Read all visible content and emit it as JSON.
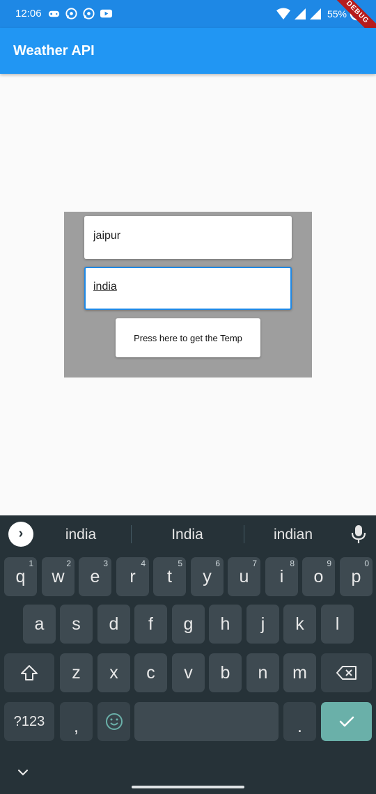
{
  "status_bar": {
    "time": "12:06",
    "battery_text": "55%",
    "debug_label": "DEBUG",
    "icons": [
      "gamepad-icon",
      "whatsapp-icon",
      "whatsapp-icon",
      "youtube-icon",
      "wifi-icon",
      "signal-icon",
      "signal-icon",
      "battery-icon"
    ]
  },
  "app_bar": {
    "title": "Weather API"
  },
  "form": {
    "city_value": "jaipur",
    "country_value": "india",
    "submit_label": "Press here to get the Temp"
  },
  "keyboard": {
    "suggestions": [
      "india",
      "India",
      "indian"
    ],
    "row1": [
      {
        "label": "q",
        "hint": "1"
      },
      {
        "label": "w",
        "hint": "2"
      },
      {
        "label": "e",
        "hint": "3"
      },
      {
        "label": "r",
        "hint": "4"
      },
      {
        "label": "t",
        "hint": "5"
      },
      {
        "label": "y",
        "hint": "6"
      },
      {
        "label": "u",
        "hint": "7"
      },
      {
        "label": "i",
        "hint": "8"
      },
      {
        "label": "o",
        "hint": "9"
      },
      {
        "label": "p",
        "hint": "0"
      }
    ],
    "row2": [
      "a",
      "s",
      "d",
      "f",
      "g",
      "h",
      "j",
      "k",
      "l"
    ],
    "row3": [
      "z",
      "x",
      "c",
      "v",
      "b",
      "n",
      "m"
    ],
    "symbols_label": "?123",
    "comma_label": ",",
    "period_label": "."
  },
  "colors": {
    "status_bar": "#1e88e5",
    "app_bar": "#2196f3",
    "panel": "#9e9e9e",
    "keyboard_bg": "#263238",
    "key_bg": "#3e4a51",
    "enter_key": "#6ab0a9",
    "focus_border": "#1e88e5"
  }
}
